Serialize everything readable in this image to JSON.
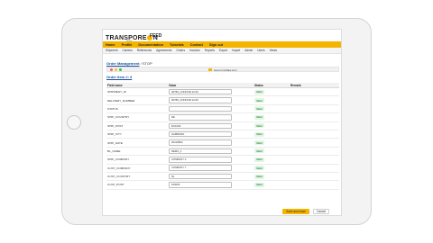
{
  "brand": {
    "logo_before": "TRANSPORE",
    "logo_after": "N",
    "logo_sub": "group",
    "app_name": "FEED"
  },
  "nav_primary": [
    "Home",
    "Profile",
    "Documentation",
    "Tutorials",
    "Contact",
    "Sign out"
  ],
  "nav_secondary": [
    "Shipment",
    "Carriers",
    "References",
    "Agreements",
    "Orders",
    "Invoices",
    "Reports",
    "Export",
    "Import",
    "Admin",
    "Users",
    "Views"
  ],
  "breadcrumb": {
    "section": "Order Management",
    "separator": "/",
    "current": "STOP"
  },
  "window": {
    "title": "feed.com/data.com"
  },
  "order_title": "Order item #: 3",
  "table": {
    "headers": {
      "field": "Field name",
      "value": "Value",
      "status": "Status",
      "remark": "Remark"
    },
    "rows": [
      {
        "field": "SHIPMENT_ID",
        "value": "00789_CONNOR-12/19",
        "status": "Valid"
      },
      {
        "field": "DELIVERY_NUMBER",
        "value": "00789_CONNOR-12/19",
        "status": "Valid"
      },
      {
        "field": "STATUS",
        "value": "",
        "status": "Valid"
      },
      {
        "field": "SHIP_COUNTRY",
        "value": "DE",
        "status": "Valid"
      },
      {
        "field": "SHIP_POST",
        "value": "DC1000",
        "status": "Valid"
      },
      {
        "field": "SHIP_CITY",
        "value": "HAMBURG",
        "status": "Valid"
      },
      {
        "field": "SHIP_DATE",
        "value": "20210803",
        "status": "Valid"
      },
      {
        "field": "BL_NAME",
        "value": "DEMO_1",
        "status": "Valid"
      },
      {
        "field": "SHIP_COMPANY",
        "value": "COMPANY X",
        "status": "Valid"
      },
      {
        "field": "CUST_COMPANY",
        "value": "COMPANY Y",
        "status": "Valid"
      },
      {
        "field": "CUST_COUNTRY",
        "value": "NL",
        "status": "Valid"
      },
      {
        "field": "CUST_POST",
        "value": "100000",
        "status": "Valid"
      }
    ]
  },
  "buttons": {
    "save": "Save and close",
    "cancel": "Cancel"
  },
  "colors": {
    "accent": "#f5b400",
    "link": "#1a4fa0",
    "valid_bg": "#e2f5e4",
    "valid_text": "#2e8b3d"
  }
}
